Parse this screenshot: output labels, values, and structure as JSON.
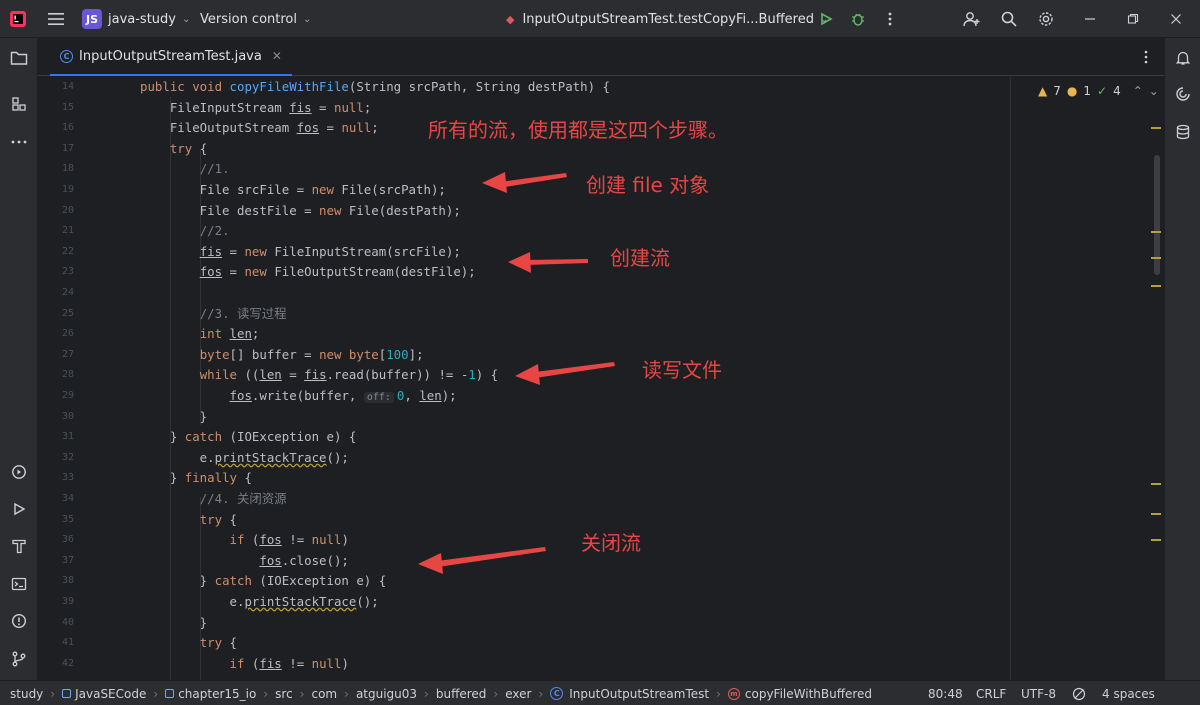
{
  "titlebar": {
    "project_badge": "JS",
    "project_name": "java-study",
    "vcs_label": "Version control",
    "run_config": "InputOutputStreamTest.testCopyFi...Buffered"
  },
  "tab": {
    "filename": "InputOutputStreamTest.java"
  },
  "inspections": {
    "warnings": "7",
    "weak_warnings": "1",
    "typos": "4"
  },
  "code_lines": [
    {
      "n": "14"
    },
    {
      "n": "15"
    },
    {
      "n": "16"
    },
    {
      "n": "17"
    },
    {
      "n": "18"
    },
    {
      "n": "19"
    },
    {
      "n": "20"
    },
    {
      "n": "21"
    },
    {
      "n": "22"
    },
    {
      "n": "23"
    },
    {
      "n": "24"
    },
    {
      "n": "25"
    },
    {
      "n": "26"
    },
    {
      "n": "27"
    },
    {
      "n": "28"
    },
    {
      "n": "29"
    },
    {
      "n": "30"
    },
    {
      "n": "31"
    },
    {
      "n": "32"
    },
    {
      "n": "33"
    },
    {
      "n": "34"
    },
    {
      "n": "35"
    },
    {
      "n": "36"
    },
    {
      "n": "37"
    },
    {
      "n": "38"
    },
    {
      "n": "39"
    },
    {
      "n": "40"
    },
    {
      "n": "41"
    },
    {
      "n": "42"
    }
  ],
  "annotations": {
    "all_streams": "所有的流，使用都是这四个步骤。",
    "create_file": "创建 file 对象",
    "create_stream": "创建流",
    "read_write": "读写文件",
    "close_stream": "关闭流"
  },
  "statusbar": {
    "crumbs": [
      "study",
      "JavaSECode",
      "chapter15_io",
      "src",
      "com",
      "atguigu03",
      "buffered",
      "exer",
      "InputOutputStreamTest",
      "copyFileWithBuffered"
    ],
    "position": "80:48",
    "line_sep": "CRLF",
    "encoding": "UTF-8",
    "indent": "4 spaces"
  },
  "colors": {
    "accent": "#3574f0",
    "annotation": "#e84545",
    "keyword": "#cf8e6d",
    "function": "#56a8f5",
    "number": "#2aacb8"
  }
}
